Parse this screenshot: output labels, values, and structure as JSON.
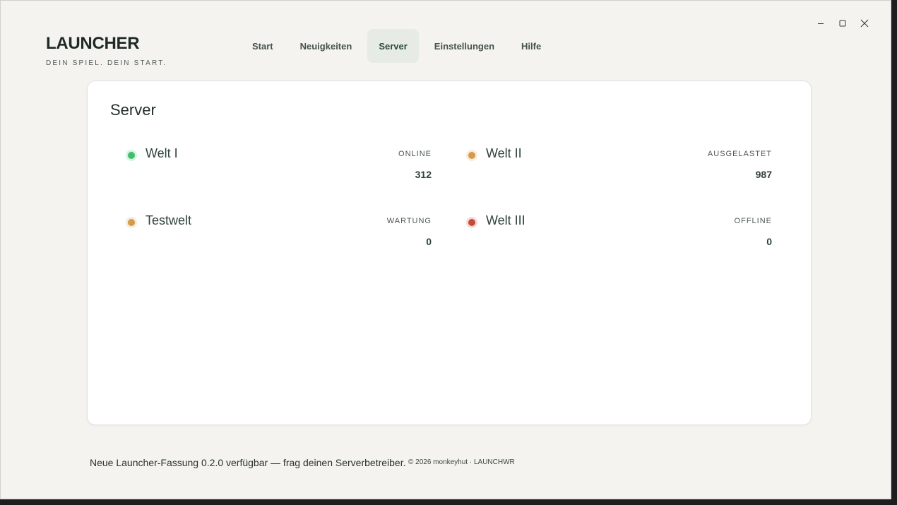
{
  "app": {
    "title": "LAUNCHER",
    "tagline": "DEIN SPIEL. DEIN START."
  },
  "nav": {
    "tabs": [
      {
        "label": "Start"
      },
      {
        "label": "Neuigkeiten"
      },
      {
        "label": "Server",
        "active": true
      },
      {
        "label": "Einstellungen"
      },
      {
        "label": "Hilfe"
      }
    ]
  },
  "main": {
    "title": "Server",
    "servers": [
      {
        "name": "Welt I",
        "status": "ONLINE",
        "players": "312",
        "color": "#3fbf6a"
      },
      {
        "name": "Welt II",
        "status": "AUSGELASTET",
        "players": "987",
        "color": "#d59a4a"
      },
      {
        "name": "Testwelt",
        "status": "WARTUNG",
        "players": "0",
        "color": "#d59a4a"
      },
      {
        "name": "Welt III",
        "status": "OFFLINE",
        "players": "0",
        "color": "#c74a3a"
      }
    ]
  },
  "footer": {
    "note": "Neue Launcher-Fassung 0.2.0 verfügbar — frag deinen Serverbetreiber.",
    "copyright": "© 2026 monkeyhut · LAUNCHWR"
  },
  "window_controls": {
    "icons": [
      "minimize-icon",
      "maximize-icon",
      "close-icon"
    ]
  },
  "colors": {
    "background": "#f4f3ef",
    "card": "#ffffff",
    "active_tab": "#e7ebe5",
    "online": "#3fbf6a",
    "warning": "#d59a4a",
    "offline": "#c74a3a"
  }
}
